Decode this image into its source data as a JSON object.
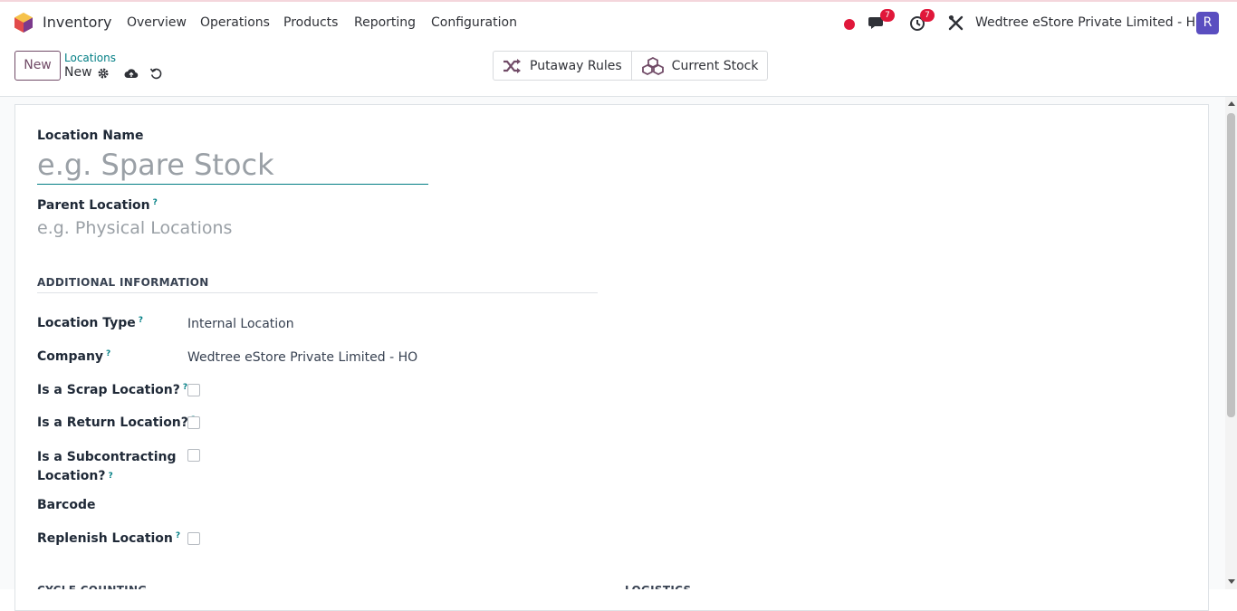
{
  "navbar": {
    "app_name": "Inventory",
    "menu": [
      "Overview",
      "Operations",
      "Products",
      "Reporting",
      "Configuration"
    ],
    "messages_badge": "7",
    "activities_badge": "7",
    "company": "Wedtree eStore Private Limited - HO",
    "avatar_letter": "R"
  },
  "control_panel": {
    "new_button": "New",
    "breadcrumb_parent": "Locations",
    "breadcrumb_current": "New",
    "smart_buttons": [
      "Putaway Rules",
      "Current Stock"
    ]
  },
  "form": {
    "location_name_label": "Location Name",
    "location_name_placeholder": "e.g. Spare Stock",
    "location_name_value": "",
    "parent_location_label": "Parent Location",
    "parent_location_placeholder": "e.g. Physical Locations",
    "section_title": "ADDITIONAL INFORMATION",
    "fields": {
      "location_type": {
        "label": "Location Type",
        "value": "Internal Location"
      },
      "company": {
        "label": "Company",
        "value": "Wedtree eStore Private Limited - HO"
      },
      "scrap": {
        "label": "Is a Scrap Location?",
        "checked": false
      },
      "return": {
        "label": "Is a Return Location?",
        "checked": false
      },
      "subcontracting": {
        "label_line1": "Is a Subcontracting",
        "label_line2": "Location?",
        "checked": false
      },
      "barcode": {
        "label": "Barcode",
        "value": ""
      },
      "replenish": {
        "label": "Replenish Location",
        "checked": false
      }
    },
    "help_mark": "?",
    "cut_section_left": "CYCLE COUNTING",
    "cut_section_right": "LOGISTICS"
  },
  "colors": {
    "brand": "#714b67",
    "teal": "#017e84",
    "badge": "#e0173a",
    "avatar": "#5a4ec0"
  }
}
